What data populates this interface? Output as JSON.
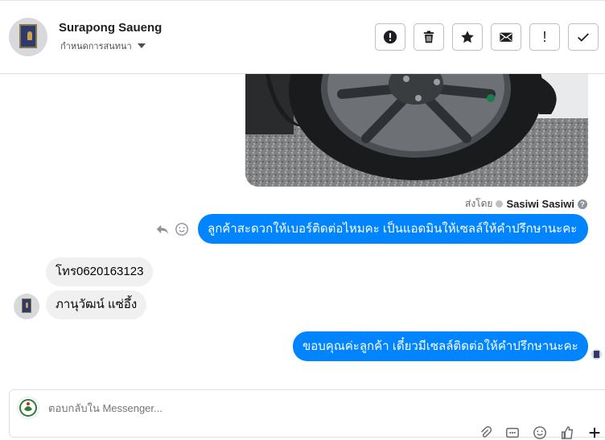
{
  "header": {
    "contact_name": "Surapong Saueng",
    "conversation_settings": "กำหนดการสนทนา",
    "actions": [
      {
        "name": "report-spam-button",
        "icon": "exclamation-circle-icon"
      },
      {
        "name": "delete-button",
        "icon": "trash-icon"
      },
      {
        "name": "star-button",
        "icon": "star-icon"
      },
      {
        "name": "mark-unread-button",
        "icon": "envelope-icon"
      },
      {
        "name": "follow-up-button",
        "icon": "exclamation-icon",
        "label": "!"
      },
      {
        "name": "mark-done-button",
        "icon": "check-icon"
      }
    ]
  },
  "messages": {
    "attachment": {
      "type": "photo",
      "subject": "car wheel and tire"
    },
    "sent_by_prefix": "ส่งโดย",
    "sent_by_agent": "Sasiwi Sasiwi",
    "sent_by_help": "?",
    "outgoing_1": "ลูกค้าสะดวกให้เบอร์ติดต่อไหมคะ เป็นแอดมินให้เซลล์ให้คำปรึกษานะคะ",
    "incoming_1": "โทร0620163123",
    "incoming_2": "ภานุวัฒน์   แซ่อึ้ง",
    "outgoing_2": "ขอบคุณค่ะลูกค้า เดี๋ยวมีเซลล์ติดต่อให้คำปรึกษานะคะ"
  },
  "composer": {
    "placeholder": "ตอบกลับใน Messenger..."
  },
  "colors": {
    "outgoing_bubble": "#0084ff",
    "incoming_bubble": "#f0f0f0",
    "border": "#dddfe2"
  }
}
